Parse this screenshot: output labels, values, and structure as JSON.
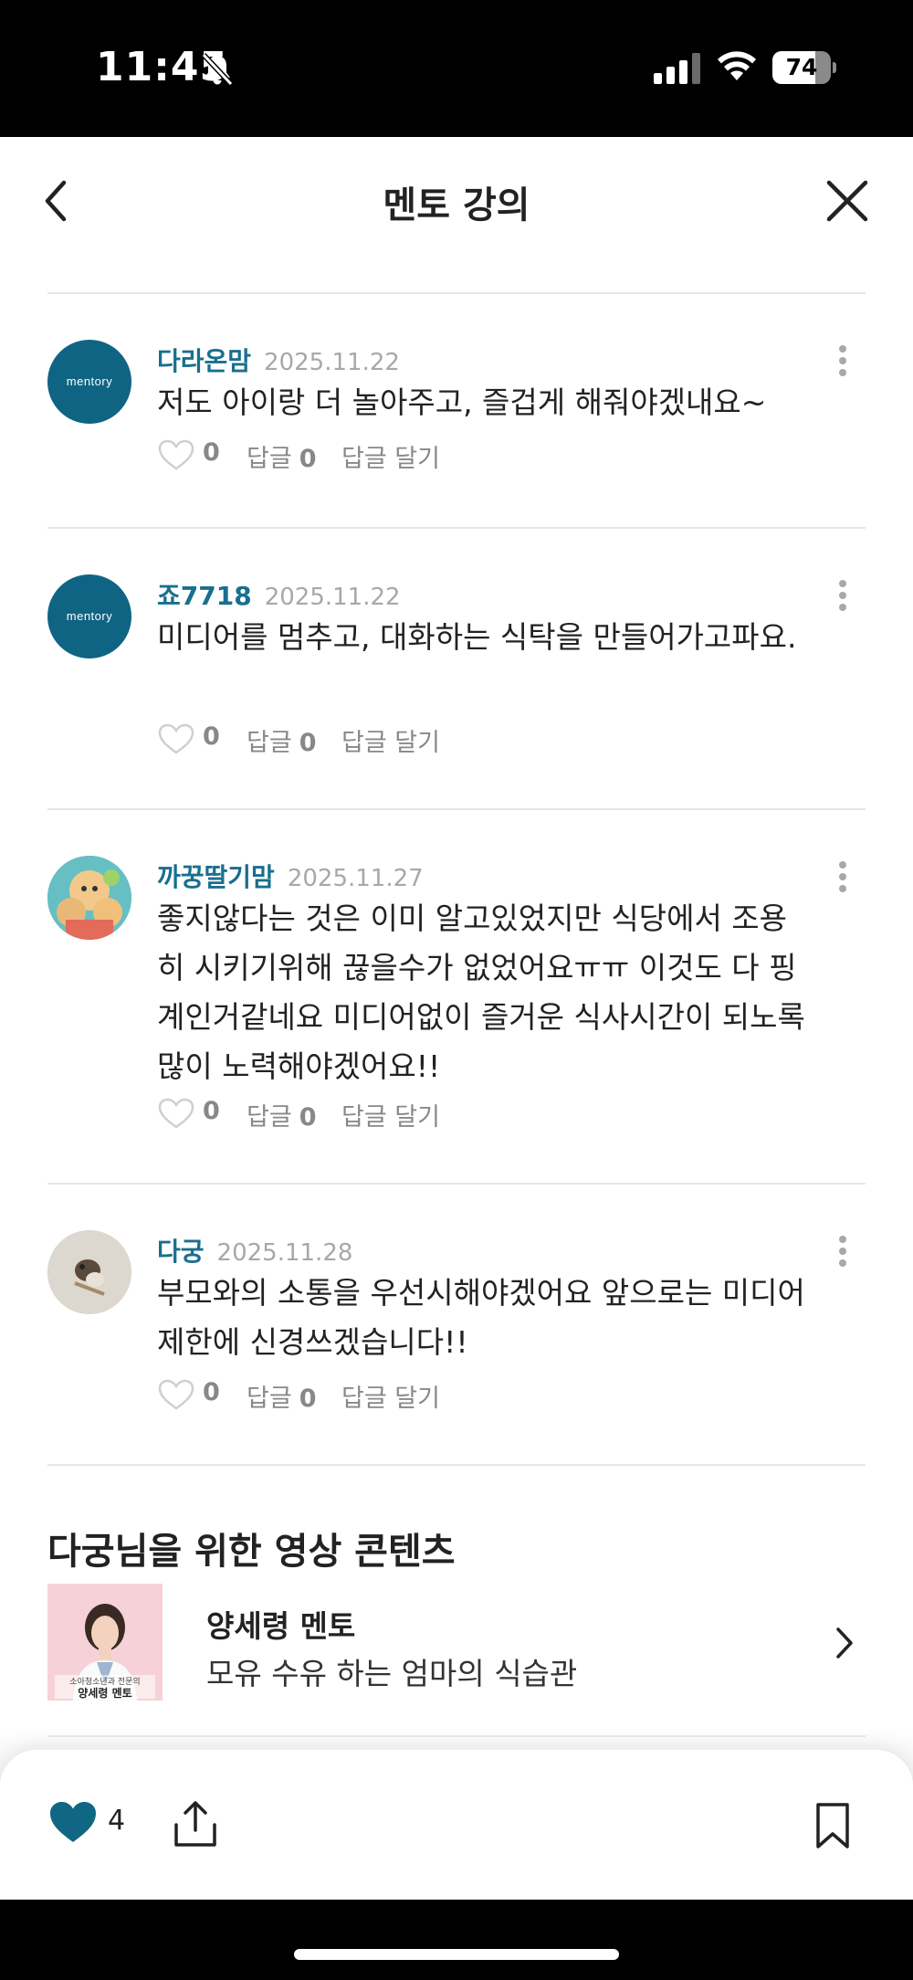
{
  "status_bar": {
    "time": "11:45",
    "battery": "74",
    "battery_level": 0.74
  },
  "header": {
    "title": "멘토 강의",
    "back_icon": "chevron-left-icon",
    "close_icon": "close-icon"
  },
  "brand_avatar_text": "mentory",
  "comments": [
    {
      "author": "다라온맘",
      "date": "2025.11.22",
      "text": "저도 아이랑 더 놀아주고, 즐겁게 해줘야겠내요~",
      "likes": "0",
      "reply_label": "답글",
      "reply_count": "0",
      "write_reply": "답글 달기"
    },
    {
      "author": "죠7718",
      "date": "2025.11.22",
      "text": "미디어를 멈추고, 대화하는 식탁을 만들어가고파요.",
      "likes": "0",
      "reply_label": "답글",
      "reply_count": "0",
      "write_reply": "답글 달기"
    },
    {
      "author": "까꿍딸기맘",
      "date": "2025.11.27",
      "text": "좋지않다는 것은 이미 알고있었지만 식당에서 조용히 시키기위해 끊을수가 없었어요ㅠㅠ 이것도 다 핑계인거같네요 미디어없이 즐거운 식사시간이 되노록 많이 노력해야겠어요!!",
      "likes": "0",
      "reply_label": "답글",
      "reply_count": "0",
      "write_reply": "답글 달기"
    },
    {
      "author": "다궁",
      "date": "2025.11.28",
      "text": "부모와의 소통을 우선시해야겠어요 앞으로는 미디어 제한에 신경쓰겠습니다!!",
      "likes": "0",
      "reply_label": "답글",
      "reply_count": "0",
      "write_reply": "답글 달기"
    }
  ],
  "video_section": {
    "title": "다궁님을 위한 영상 콘텐츠",
    "items": [
      {
        "mentor": "양세령 멘토",
        "title": "모유 수유 하는 엄마의 식습관",
        "thumb_caption_small": "소아청소년과 전문의",
        "thumb_caption": "양세령 멘토"
      }
    ]
  },
  "bottom_bar": {
    "like_count": "4",
    "like_icon": "heart-filled-icon",
    "share_icon": "share-icon",
    "bookmark_icon": "bookmark-icon"
  },
  "colors": {
    "accent": "#1a6f8f",
    "brand_avatar": "#0f6484",
    "heart": "#106784"
  }
}
